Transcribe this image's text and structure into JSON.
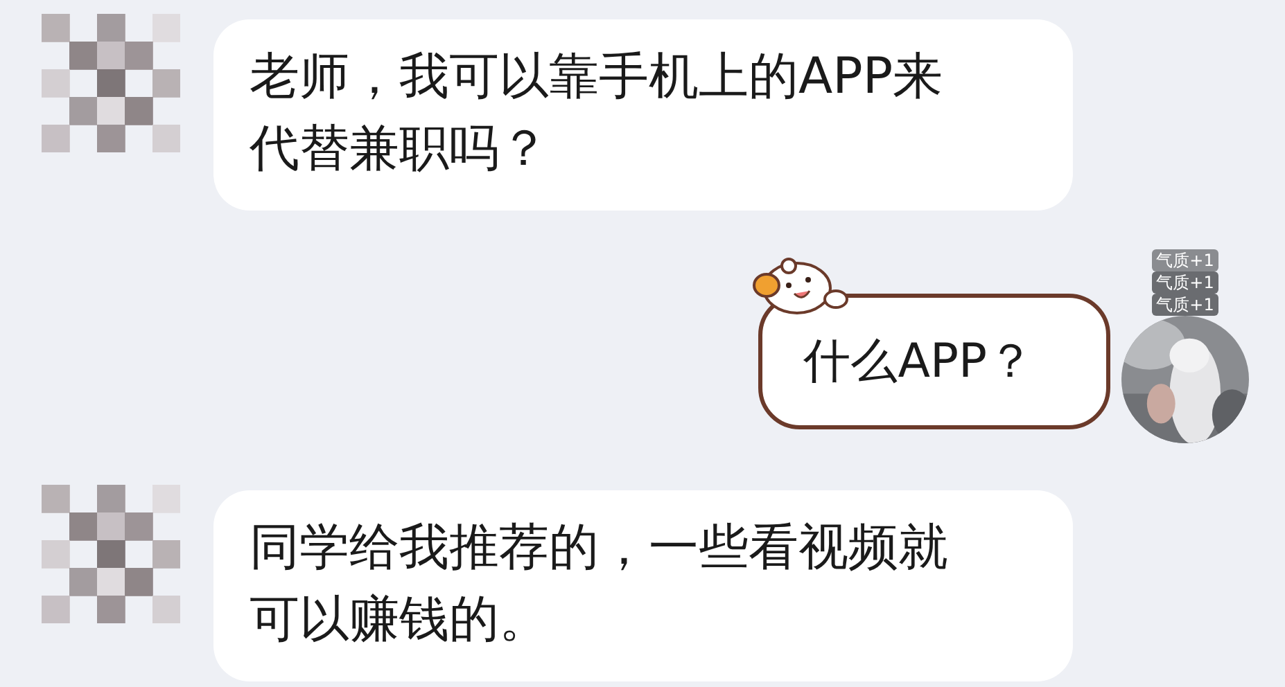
{
  "messages": [
    {
      "kind": "incoming",
      "lines": [
        "老师，我可以靠手机上的APP来",
        "代替兼职吗？"
      ],
      "avatar": {
        "kind": "picture"
      }
    },
    {
      "kind": "outgoing",
      "lines": [
        "什么APP？"
      ],
      "avatar": {
        "kind": "picture",
        "badges": [
          "气质+1",
          "气质+1",
          "气质+1"
        ]
      }
    },
    {
      "kind": "incoming",
      "lines": [
        "同学给我推荐的，一些看视频就",
        "可以赚钱的。"
      ],
      "avatar": {
        "kind": "picture"
      }
    }
  ]
}
